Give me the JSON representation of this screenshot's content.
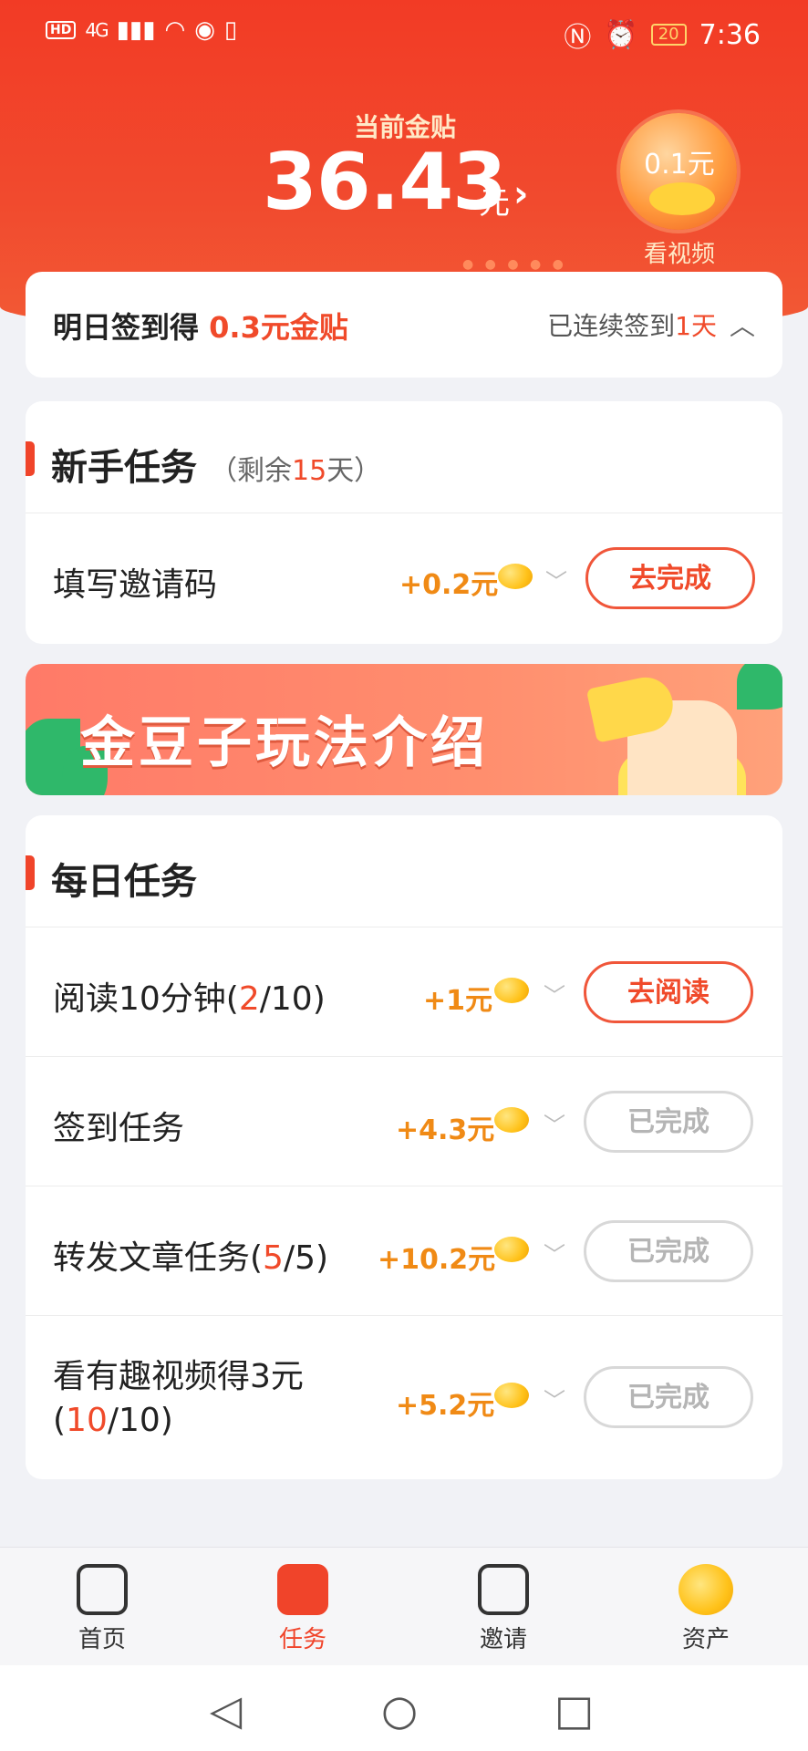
{
  "status_bar": {
    "hd": "HD",
    "network": "4G",
    "battery": "20",
    "time": "7:36"
  },
  "header": {
    "label": "当前金贴",
    "amount": "36.43",
    "unit": "元",
    "arrow": "›",
    "bubble_value": "0.1元",
    "bubble_label": "看视频"
  },
  "signin": {
    "prefix": "明日签到得 ",
    "reward": "0.3元金贴",
    "streak_prefix": "已连续签到",
    "streak_value": "1天",
    "toggle_icon": "chevron-up-icon"
  },
  "newbie": {
    "title": "新手任务",
    "note_open": "（剩余",
    "note_days": "15",
    "note_close": "天）",
    "tasks": [
      {
        "name": "填写邀请码",
        "reward": "+0.2元",
        "button": "去完成",
        "state": "active"
      }
    ]
  },
  "banner": {
    "text": "金豆子玩法介绍"
  },
  "daily": {
    "title": "每日任务",
    "tasks": [
      {
        "name_a": "阅读10分钟(",
        "count": "2",
        "name_b": "/10)",
        "reward": "+1元",
        "button": "去阅读",
        "state": "active"
      },
      {
        "name_a": "签到任务",
        "count": "",
        "name_b": "",
        "reward": "+4.3元",
        "button": "已完成",
        "state": "done"
      },
      {
        "name_a": "转发文章任务(",
        "count": "5",
        "name_b": "/5)",
        "reward": "+10.2元",
        "button": "已完成",
        "state": "done"
      },
      {
        "name_a": "看有趣视频得3元",
        "line2_a": "(",
        "count": "10",
        "name_b": "/10)",
        "reward": "+5.2元",
        "button": "已完成",
        "state": "done"
      }
    ]
  },
  "bottom_nav": {
    "items": [
      {
        "label": "首页",
        "icon": "home-play-icon"
      },
      {
        "label": "任务",
        "icon": "task-bookmark-icon",
        "active": true
      },
      {
        "label": "邀请",
        "icon": "invite-envelope-icon"
      },
      {
        "label": "资产",
        "icon": "gold-beans-icon"
      }
    ]
  },
  "system_nav": {
    "back": "◁",
    "home": "○",
    "recent": "□"
  },
  "colors": {
    "brand_red": "#f0442a",
    "reward_orange": "#f08a15",
    "done_gray": "#b5b5b5"
  }
}
